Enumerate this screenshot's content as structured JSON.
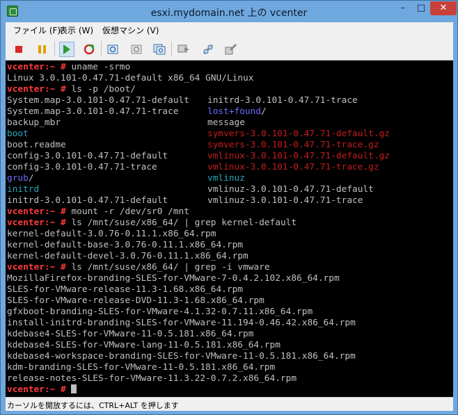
{
  "window": {
    "title": "esxi.mydomain.net 上の vcenter"
  },
  "menu": [
    "ファイル (F)",
    "表示 (W)",
    "仮想マシン (V)"
  ],
  "toolbar": {
    "icons": [
      "stop-icon",
      "pause-icon",
      "play-icon",
      "reset-icon",
      "snapshot-icon",
      "revert-snapshot-icon",
      "manage-snapshots-icon",
      "console-icon",
      "network-icon",
      "settings-icon"
    ],
    "colors": {
      "stop": "#d42a2a",
      "pause": "#e2a000",
      "play": "#2d9b2d",
      "reset": "#2d9b2d"
    }
  },
  "terminal": {
    "prompt": "vcenter:~ #",
    "colors": {
      "prompt": "#ff3a3a",
      "text": "#c0c0c0",
      "dir_cyan": "#28a6bb",
      "dir_blue": "#6b6bff",
      "archive_red": "#c41d1d"
    },
    "cmd1": "uname -srmo",
    "out1": "Linux 3.0.101-0.47.71-default x86_64 GNU/Linux",
    "cmd2": "ls -p /boot/",
    "ls": [
      [
        "System.map-3.0.101-0.47.71-default",
        "initrd-3.0.101-0.47.71-trace"
      ],
      [
        "System.map-3.0.101-0.47.71-trace",
        "lost+found"
      ],
      [
        "backup_mbr",
        "message"
      ],
      [
        "boot",
        "symvers-3.0.101-0.47.71-default.gz"
      ],
      [
        "boot.readme",
        "symvers-3.0.101-0.47.71-trace.gz"
      ],
      [
        "config-3.0.101-0.47.71-default",
        "vmlinux-3.0.101-0.47.71-default.gz"
      ],
      [
        "config-3.0.101-0.47.71-trace",
        "vmlinux-3.0.101-0.47.71-trace.gz"
      ],
      [
        "grub",
        "vmlinuz"
      ],
      [
        "initrd",
        "vmlinuz-3.0.101-0.47.71-default"
      ],
      [
        "initrd-3.0.101-0.47.71-default",
        "vmlinuz-3.0.101-0.47.71-trace"
      ]
    ],
    "slash": "/",
    "cmd3": "mount -r /dev/sr0 /mnt",
    "cmd4": "ls /mnt/suse/x86_64/ | grep kernel-default",
    "out4": [
      "kernel-default-3.0.76-0.11.1.x86_64.rpm",
      "kernel-default-base-3.0.76-0.11.1.x86_64.rpm",
      "kernel-default-devel-3.0.76-0.11.1.x86_64.rpm"
    ],
    "cmd5": "ls /mnt/suse/x86_64/ | grep -i vmware",
    "out5": [
      "MozillaFirefox-branding-SLES-for-VMware-7-0.4.2.102.x86_64.rpm",
      "SLES-for-VMware-release-11.3-1.68.x86_64.rpm",
      "SLES-for-VMware-release-DVD-11.3-1.68.x86_64.rpm",
      "gfxboot-branding-SLES-for-VMware-4.1.32-0.7.11.x86_64.rpm",
      "install-initrd-branding-SLES-for-VMware-11.194-0.46.42.x86_64.rpm",
      "kdebase4-SLES-for-VMware-11-0.5.181.x86_64.rpm",
      "kdebase4-SLES-for-VMware-lang-11-0.5.181.x86_64.rpm",
      "kdebase4-workspace-branding-SLES-for-VMware-11-0.5.181.x86_64.rpm",
      "kdm-branding-SLES-for-VMware-11-0.5.181.x86_64.rpm",
      "release-notes-SLES-for-VMware-11.3.22-0.7.2.x86_64.rpm"
    ]
  },
  "status": {
    "text": "カーソルを開放するには、CTRL+ALT を押します"
  }
}
